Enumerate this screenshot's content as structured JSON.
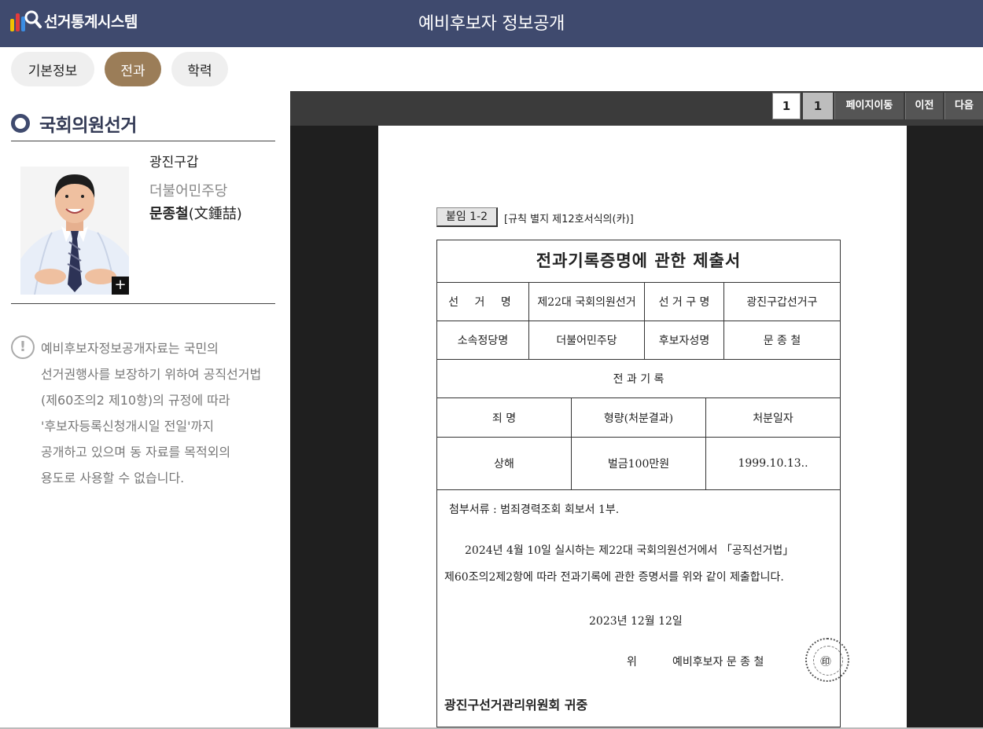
{
  "header": {
    "logo_text": "선거통계시스템",
    "title": "예비후보자 정보공개",
    "bg_color": "#3f4a6e"
  },
  "tabs": [
    {
      "label": "기본정보",
      "active": false
    },
    {
      "label": "전과",
      "active": true
    },
    {
      "label": "학력",
      "active": false
    }
  ],
  "candidate": {
    "election": "국회의원선거",
    "district": "광진구갑",
    "party": "더불어민주당",
    "name": "문종철",
    "name_hanja": "(文鍾喆)",
    "photo_expand_label": "+"
  },
  "notice": {
    "icon": "!",
    "lines": [
      "예비후보자정보공개자료는 국민의",
      "선거권행사를 보장하기 위하여 공직선거법",
      "(제60조의2 제10항)의 규정에 따라",
      "'후보자등록신청개시일 전일'까지",
      "공개하고 있으며 동 자료를 목적외의",
      "용도로 사용할 수 없습니다."
    ]
  },
  "viewer": {
    "current_page": "1",
    "total_pages": "1",
    "goto_label": "페이지이동",
    "prev_label": "이전",
    "next_label": "다음"
  },
  "document": {
    "attach_label": "붙임 1-2",
    "rule_ref": "[규칙 별지 제12호서식의(카)]",
    "title": "전과기록증명에 관한 제출서",
    "election_label": "선 거 명",
    "election_value": "제22대 국회의원선거",
    "district_label": "선 거 구 명",
    "district_value": "광진구갑선거구",
    "party_label": "소속정당명",
    "party_value": "더불어민주당",
    "cand_label": "후보자성명",
    "cand_value": "문  종  철",
    "record_header": "전 과 기 록",
    "col_crime": "죄  명",
    "col_penalty": "형량(처분결과)",
    "col_date": "처분일자",
    "records": [
      {
        "crime": "상해",
        "penalty": "벌금100만원",
        "date": "1999.10.13.."
      }
    ],
    "attachment": "첨부서류 : 범죄경력조회 회보서 1부.",
    "body_line1": "2024년 4월 10일 실시하는 제22대 국회의원선거에서 「공직선거법」",
    "body_line2": "제60조의2제2항에 따라 전과기록에 관한 증명서를 위와 같이 제출합니다.",
    "date": "2023년  12월  12일",
    "signer_prefix": "위",
    "signer": "예비후보자  문  종  철",
    "seal_mark": "㊞",
    "recipient": "광진구선거관리위원회 귀중"
  }
}
